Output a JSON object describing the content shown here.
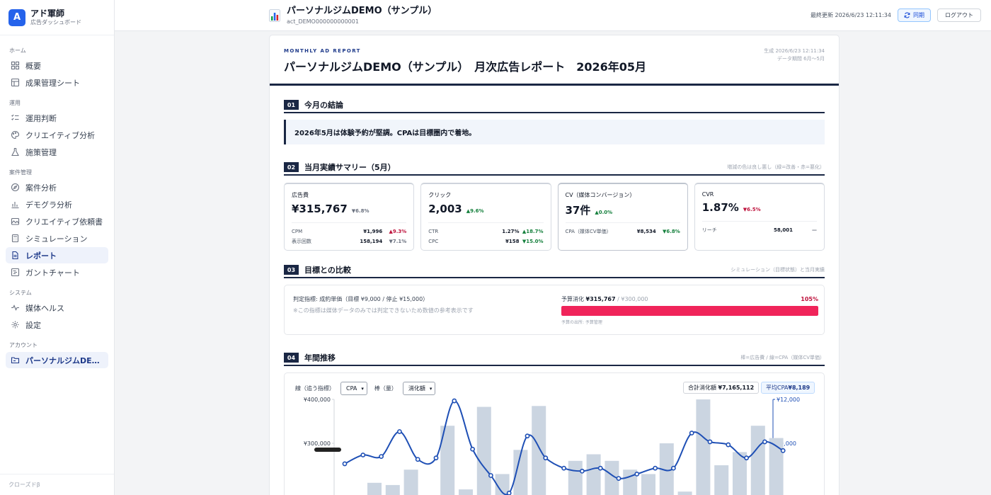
{
  "brand": {
    "logo_letter": "A",
    "name": "アド軍師",
    "subtitle": "広告ダッシュボード"
  },
  "nav": [
    {
      "section": "ホーム",
      "items": [
        {
          "label": "概要",
          "icon": "grid-icon"
        },
        {
          "label": "成果管理シート",
          "icon": "table-icon"
        }
      ]
    },
    {
      "section": "運用",
      "items": [
        {
          "label": "運用判断",
          "icon": "checklist-icon"
        },
        {
          "label": "クリエイティブ分析",
          "icon": "palette-icon"
        },
        {
          "label": "施策管理",
          "icon": "flask-icon"
        }
      ]
    },
    {
      "section": "案件管理",
      "items": [
        {
          "label": "案件分析",
          "icon": "compass-icon"
        },
        {
          "label": "デモグラ分析",
          "icon": "bar-chart-icon"
        },
        {
          "label": "クリエイティブ依頼書",
          "icon": "image-icon"
        },
        {
          "label": "シミュレーション",
          "icon": "calculator-icon"
        },
        {
          "label": "レポート",
          "icon": "document-icon",
          "active": true
        },
        {
          "label": "ガントチャート",
          "icon": "gantt-icon"
        }
      ]
    },
    {
      "section": "システム",
      "items": [
        {
          "label": "媒体ヘルス",
          "icon": "pulse-icon"
        },
        {
          "label": "設定",
          "icon": "gear-icon"
        }
      ]
    },
    {
      "section": "アカウント",
      "items": [
        {
          "label": "パーソナルジムDEM...",
          "icon": "folder-icon",
          "active": true
        }
      ]
    }
  ],
  "sidebar_footer": "クローズドβ",
  "topbar": {
    "title": "パーソナルジムDEMO（サンプル）",
    "account_id": "act_DEMO000000000001",
    "updated": "最終更新 2026/6/23 12:11:34",
    "sync_label": "同期",
    "logout_label": "ログアウト"
  },
  "report": {
    "eyebrow": "MONTHLY AD REPORT",
    "title": "パーソナルジムDEMO（サンプル）　月次広告レポート　2026年05月",
    "generated": "生成 2026/6/23 12:11:34",
    "period": "データ期間 6月〜5月",
    "s1": {
      "num": "01",
      "title": "今月の結論",
      "conclusion": "2026年5月は体験予約が堅調。CPAは目標圏内で着地。"
    },
    "s2": {
      "num": "02",
      "title": "当月実績サマリー（5月）",
      "note": "増減の色は良し悪し（緑=改善・赤=悪化）",
      "kpis": [
        {
          "label": "広告費",
          "value": "¥315,767",
          "delta": "▼6.8%",
          "tone": "neu",
          "rows": [
            {
              "k": "CPM",
              "v": "¥1,996",
              "d": "▲9.3%",
              "tone": "down"
            },
            {
              "k": "表示回数",
              "v": "158,194",
              "d": "▼7.1%",
              "tone": "neu"
            }
          ]
        },
        {
          "label": "クリック",
          "value": "2,003",
          "delta": "▲9.6%",
          "tone": "up",
          "rows": [
            {
              "k": "CTR",
              "v": "1.27%",
              "d": "▲18.7%",
              "tone": "up"
            },
            {
              "k": "CPC",
              "v": "¥158",
              "d": "▼15.0%",
              "tone": "up"
            }
          ]
        },
        {
          "label": "CV（媒体コンバージョン）",
          "value": "37件",
          "delta": "▲0.0%",
          "tone": "up",
          "rows": [
            {
              "k": "CPA（媒体CV単価）",
              "v": "¥8,534",
              "d": "▼6.8%",
              "tone": "up"
            }
          ]
        },
        {
          "label": "CVR",
          "value": "1.87%",
          "delta": "▼6.5%",
          "tone": "down",
          "rows": [
            {
              "k": "リーチ",
              "v": "58,001",
              "d": "—",
              "tone": "neu"
            }
          ]
        }
      ]
    },
    "s3": {
      "num": "03",
      "title": "目標との比較",
      "note": "シミュレーション（目標状態）と当月実績",
      "indicator": "判定指標: 成約単価（目標 ¥9,000 / 停止 ¥15,000）",
      "indicator_note": "※この指標は媒体データのみでは判定できないため数値の参考表示です",
      "budget_label": "予算消化",
      "budget_used": "¥315,767",
      "budget_total": "/ ¥300,000",
      "budget_pct": "105%",
      "budget_ratio": 1.0,
      "budget_foot": "予算の出所: 予算管理"
    },
    "s4": {
      "num": "04",
      "title": "年間推移",
      "note": "棒=広告費 / 線=CPA（媒体CV単価）",
      "line_label": "線（追う指標）",
      "line_select": "CPA",
      "bar_label": "棒（量）",
      "bar_select": "消化額",
      "total_label": "合計消化額",
      "total_value": "¥7,165,112",
      "avg_label": "平均CPA",
      "avg_value": "¥8,189"
    }
  },
  "chart_data": {
    "type": "bar",
    "left_axis": {
      "ticks": [
        "¥400,000",
        "¥300,000"
      ],
      "range": [
        0,
        400000
      ]
    },
    "right_axis": {
      "ticks": [
        "¥12,000",
        "¥9,000"
      ],
      "range": [
        0,
        12000
      ]
    },
    "bar_values": [
      210000,
      205000,
      240000,
      100000,
      340000,
      195000,
      383000,
      230000,
      285000,
      385000,
      180000,
      260000,
      275000,
      260000,
      240000,
      230000,
      300000,
      190000,
      400000,
      250000,
      280000,
      340000,
      312000
    ],
    "line_values": [
      7600,
      8200,
      8100,
      9800,
      7900,
      8000,
      11900,
      8600,
      6800,
      5600,
      9500,
      8000,
      7300,
      7100,
      7300,
      6600,
      6900,
      7300,
      7300,
      9700,
      9100,
      8900,
      8000,
      9100,
      8500
    ],
    "colors": {
      "bar": "#cbd5e1",
      "line": "#1e4fb5",
      "axis_left": "#d1d5db",
      "axis_right": "#1e4fb5"
    }
  }
}
